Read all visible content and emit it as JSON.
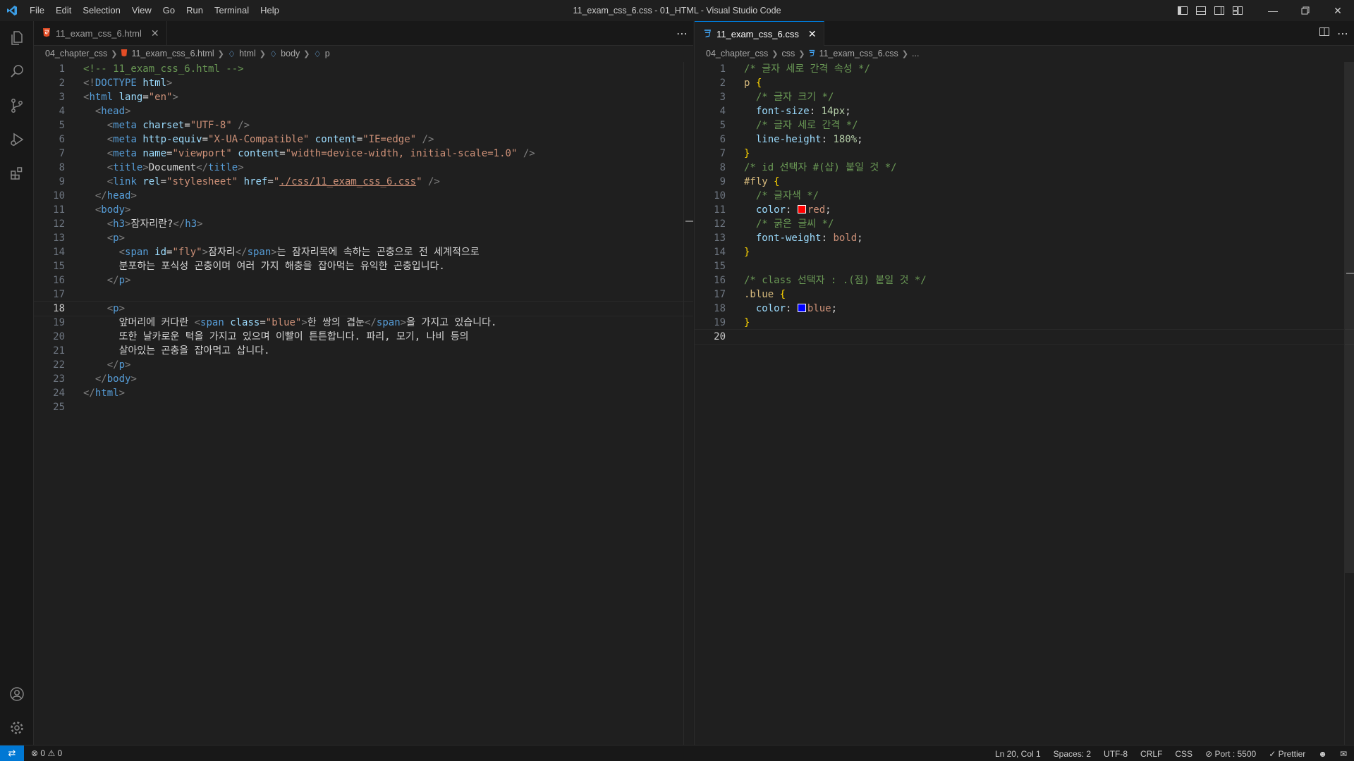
{
  "window": {
    "title": "11_exam_css_6.css - 01_HTML - Visual Studio Code",
    "menu": [
      "File",
      "Edit",
      "Selection",
      "View",
      "Go",
      "Run",
      "Terminal",
      "Help"
    ]
  },
  "left_editor": {
    "tab_label": "11_exam_css_6.html",
    "breadcrumb": [
      "04_chapter_css",
      "11_exam_css_6.html",
      "html",
      "body",
      "p"
    ],
    "current_line": 18,
    "lines": [
      [
        [
          "c-com",
          "<!-- 11_exam_css_6.html -->"
        ]
      ],
      [
        [
          "c-punc",
          "<!"
        ],
        [
          "c-tag",
          "DOCTYPE"
        ],
        [
          "c-text",
          " "
        ],
        [
          "c-attr",
          "html"
        ],
        [
          "c-punc",
          ">"
        ]
      ],
      [
        [
          "c-punc",
          "<"
        ],
        [
          "c-tag",
          "html"
        ],
        [
          "c-text",
          " "
        ],
        [
          "c-attr",
          "lang"
        ],
        [
          "c-text",
          "="
        ],
        [
          "c-str",
          "\"en\""
        ],
        [
          "c-punc",
          ">"
        ]
      ],
      [
        [
          "c-text",
          "  "
        ],
        [
          "c-punc",
          "<"
        ],
        [
          "c-tag",
          "head"
        ],
        [
          "c-punc",
          ">"
        ]
      ],
      [
        [
          "c-text",
          "    "
        ],
        [
          "c-punc",
          "<"
        ],
        [
          "c-tag",
          "meta"
        ],
        [
          "c-text",
          " "
        ],
        [
          "c-attr",
          "charset"
        ],
        [
          "c-text",
          "="
        ],
        [
          "c-str",
          "\"UTF-8\""
        ],
        [
          "c-text",
          " "
        ],
        [
          "c-punc",
          "/>"
        ]
      ],
      [
        [
          "c-text",
          "    "
        ],
        [
          "c-punc",
          "<"
        ],
        [
          "c-tag",
          "meta"
        ],
        [
          "c-text",
          " "
        ],
        [
          "c-attr",
          "http-equiv"
        ],
        [
          "c-text",
          "="
        ],
        [
          "c-str",
          "\"X-UA-Compatible\""
        ],
        [
          "c-text",
          " "
        ],
        [
          "c-attr",
          "content"
        ],
        [
          "c-text",
          "="
        ],
        [
          "c-str",
          "\"IE=edge\""
        ],
        [
          "c-text",
          " "
        ],
        [
          "c-punc",
          "/>"
        ]
      ],
      [
        [
          "c-text",
          "    "
        ],
        [
          "c-punc",
          "<"
        ],
        [
          "c-tag",
          "meta"
        ],
        [
          "c-text",
          " "
        ],
        [
          "c-attr",
          "name"
        ],
        [
          "c-text",
          "="
        ],
        [
          "c-str",
          "\"viewport\""
        ],
        [
          "c-text",
          " "
        ],
        [
          "c-attr",
          "content"
        ],
        [
          "c-text",
          "="
        ],
        [
          "c-str",
          "\"width=device-width, initial-scale=1.0\""
        ],
        [
          "c-text",
          " "
        ],
        [
          "c-punc",
          "/>"
        ]
      ],
      [
        [
          "c-text",
          "    "
        ],
        [
          "c-punc",
          "<"
        ],
        [
          "c-tag",
          "title"
        ],
        [
          "c-punc",
          ">"
        ],
        [
          "c-text",
          "Document"
        ],
        [
          "c-punc",
          "</"
        ],
        [
          "c-tag",
          "title"
        ],
        [
          "c-punc",
          ">"
        ]
      ],
      [
        [
          "c-text",
          "    "
        ],
        [
          "c-punc",
          "<"
        ],
        [
          "c-tag",
          "link"
        ],
        [
          "c-text",
          " "
        ],
        [
          "c-attr",
          "rel"
        ],
        [
          "c-text",
          "="
        ],
        [
          "c-str",
          "\"stylesheet\""
        ],
        [
          "c-text",
          " "
        ],
        [
          "c-attr",
          "href"
        ],
        [
          "c-text",
          "="
        ],
        [
          "c-str",
          "\""
        ],
        [
          "c-link",
          "./css/11_exam_css_6.css"
        ],
        [
          "c-str",
          "\""
        ],
        [
          "c-text",
          " "
        ],
        [
          "c-punc",
          "/>"
        ]
      ],
      [
        [
          "c-text",
          "  "
        ],
        [
          "c-punc",
          "</"
        ],
        [
          "c-tag",
          "head"
        ],
        [
          "c-punc",
          ">"
        ]
      ],
      [
        [
          "c-text",
          "  "
        ],
        [
          "c-punc",
          "<"
        ],
        [
          "c-tag",
          "body"
        ],
        [
          "c-punc",
          ">"
        ]
      ],
      [
        [
          "c-text",
          "    "
        ],
        [
          "c-punc",
          "<"
        ],
        [
          "c-tag",
          "h3"
        ],
        [
          "c-punc",
          ">"
        ],
        [
          "c-text",
          "잠자리란?"
        ],
        [
          "c-punc",
          "</"
        ],
        [
          "c-tag",
          "h3"
        ],
        [
          "c-punc",
          ">"
        ]
      ],
      [
        [
          "c-text",
          "    "
        ],
        [
          "c-punc",
          "<"
        ],
        [
          "c-tag",
          "p"
        ],
        [
          "c-punc",
          ">"
        ]
      ],
      [
        [
          "c-text",
          "      "
        ],
        [
          "c-punc",
          "<"
        ],
        [
          "c-tag",
          "span"
        ],
        [
          "c-text",
          " "
        ],
        [
          "c-attr",
          "id"
        ],
        [
          "c-text",
          "="
        ],
        [
          "c-str",
          "\"fly\""
        ],
        [
          "c-punc",
          ">"
        ],
        [
          "c-text",
          "잠자리"
        ],
        [
          "c-punc",
          "</"
        ],
        [
          "c-tag",
          "span"
        ],
        [
          "c-punc",
          ">"
        ],
        [
          "c-text",
          "는 잠자리목에 속하는 곤충으로 전 세계적으로"
        ]
      ],
      [
        [
          "c-text",
          "      분포하는 포식성 곤충이며 여러 가지 해충을 잡아먹는 유익한 곤충입니다."
        ]
      ],
      [
        [
          "c-text",
          "    "
        ],
        [
          "c-punc",
          "</"
        ],
        [
          "c-tag",
          "p"
        ],
        [
          "c-punc",
          ">"
        ]
      ],
      [
        [
          "c-text",
          ""
        ]
      ],
      [
        [
          "c-text",
          "    "
        ],
        [
          "c-punc",
          "<"
        ],
        [
          "c-tag",
          "p"
        ],
        [
          "c-punc",
          ">"
        ]
      ],
      [
        [
          "c-text",
          "      앞머리에 커다란 "
        ],
        [
          "c-punc",
          "<"
        ],
        [
          "c-tag",
          "span"
        ],
        [
          "c-text",
          " "
        ],
        [
          "c-attr",
          "class"
        ],
        [
          "c-text",
          "="
        ],
        [
          "c-str",
          "\"blue\""
        ],
        [
          "c-punc",
          ">"
        ],
        [
          "c-text",
          "한 쌍의 겹눈"
        ],
        [
          "c-punc",
          "</"
        ],
        [
          "c-tag",
          "span"
        ],
        [
          "c-punc",
          ">"
        ],
        [
          "c-text",
          "을 가지고 있습니다."
        ]
      ],
      [
        [
          "c-text",
          "      또한 날카로운 턱을 가지고 있으며 이빨이 튼튼합니다. 파리, 모기, 나비 등의"
        ]
      ],
      [
        [
          "c-text",
          "      살아있는 곤충을 잡아먹고 삽니다."
        ]
      ],
      [
        [
          "c-text",
          "    "
        ],
        [
          "c-punc",
          "</"
        ],
        [
          "c-tag",
          "p"
        ],
        [
          "c-punc",
          ">"
        ]
      ],
      [
        [
          "c-text",
          "  "
        ],
        [
          "c-punc",
          "</"
        ],
        [
          "c-tag",
          "body"
        ],
        [
          "c-punc",
          ">"
        ]
      ],
      [
        [
          "c-punc",
          "</"
        ],
        [
          "c-tag",
          "html"
        ],
        [
          "c-punc",
          ">"
        ]
      ],
      [
        [
          "c-text",
          ""
        ]
      ]
    ]
  },
  "right_editor": {
    "tab_label": "11_exam_css_6.css",
    "breadcrumb": [
      "04_chapter_css",
      "css",
      "11_exam_css_6.css",
      "..."
    ],
    "current_line": 20,
    "lines": [
      [
        [
          "c-com",
          "/* 글자 세로 간격 속성 */"
        ]
      ],
      [
        [
          "c-tsel",
          "p"
        ],
        [
          "c-text",
          " "
        ],
        [
          "c-brace",
          "{"
        ]
      ],
      [
        [
          "c-text",
          "  "
        ],
        [
          "c-com",
          "/* 글자 크기 */"
        ]
      ],
      [
        [
          "c-text",
          "  "
        ],
        [
          "c-prop",
          "font-size"
        ],
        [
          "c-text",
          ": "
        ],
        [
          "c-num",
          "14px"
        ],
        [
          "c-text",
          ";"
        ]
      ],
      [
        [
          "c-text",
          "  "
        ],
        [
          "c-com",
          "/* 글자 세로 간격 */"
        ]
      ],
      [
        [
          "c-text",
          "  "
        ],
        [
          "c-prop",
          "line-height"
        ],
        [
          "c-text",
          ": "
        ],
        [
          "c-num",
          "180%"
        ],
        [
          "c-text",
          ";"
        ]
      ],
      [
        [
          "c-brace",
          "}"
        ]
      ],
      [
        [
          "c-com",
          "/* id 선택자 #(샵) 붙일 것 */"
        ]
      ],
      [
        [
          "c-sel",
          "#fly"
        ],
        [
          "c-text",
          " "
        ],
        [
          "c-brace",
          "{"
        ]
      ],
      [
        [
          "c-text",
          "  "
        ],
        [
          "c-com",
          "/* 글자색 */"
        ]
      ],
      [
        [
          "c-text",
          "  "
        ],
        [
          "c-prop",
          "color"
        ],
        [
          "c-text",
          ": "
        ],
        [
          "swatch-red",
          ""
        ],
        [
          "c-val",
          "red"
        ],
        [
          "c-text",
          ";"
        ]
      ],
      [
        [
          "c-text",
          "  "
        ],
        [
          "c-com",
          "/* 굵은 글씨 */"
        ]
      ],
      [
        [
          "c-text",
          "  "
        ],
        [
          "c-prop",
          "font-weight"
        ],
        [
          "c-text",
          ": "
        ],
        [
          "c-val",
          "bold"
        ],
        [
          "c-text",
          ";"
        ]
      ],
      [
        [
          "c-brace",
          "}"
        ]
      ],
      [
        [
          "c-text",
          ""
        ]
      ],
      [
        [
          "c-com",
          "/* class 선택자 : .(점) 붙일 것 */"
        ]
      ],
      [
        [
          "c-sel",
          ".blue"
        ],
        [
          "c-text",
          " "
        ],
        [
          "c-brace",
          "{"
        ]
      ],
      [
        [
          "c-text",
          "  "
        ],
        [
          "c-prop",
          "color"
        ],
        [
          "c-text",
          ": "
        ],
        [
          "swatch-blue",
          ""
        ],
        [
          "c-val",
          "blue"
        ],
        [
          "c-text",
          ";"
        ]
      ],
      [
        [
          "c-brace",
          "}"
        ]
      ],
      [
        [
          "c-text",
          ""
        ]
      ]
    ]
  },
  "statusbar": {
    "problems": "0",
    "warnings": "0",
    "position": "Ln 20, Col 1",
    "spaces": "Spaces: 2",
    "encoding": "UTF-8",
    "eol": "CRLF",
    "language": "CSS",
    "port": "Port : 5500",
    "prettier": "Prettier"
  },
  "colors": {
    "accent": "#0078d4",
    "swatch_red": "#ff0000",
    "swatch_blue": "#0000ff"
  },
  "icons": {
    "activity": [
      "explorer-icon",
      "search-icon",
      "source-control-icon",
      "run-debug-icon",
      "extensions-icon",
      "accounts-icon",
      "settings-gear-icon"
    ]
  }
}
